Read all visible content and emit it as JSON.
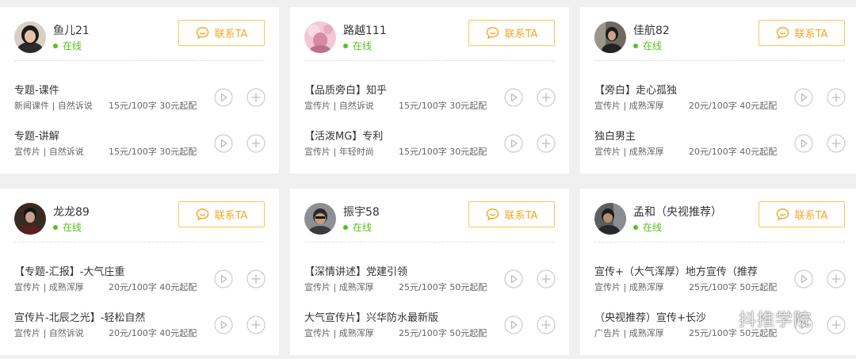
{
  "cards": [
    {
      "name": "鱼儿21",
      "status": "在线",
      "contact_label": "联系TA",
      "items": [
        {
          "title": "专题-课件",
          "tags": "新闻课件 | 自然诉说",
          "price": "15元/100字 30元起配"
        },
        {
          "title": "专题-讲解",
          "tags": "宣传片 | 自然诉说",
          "price": "15元/100字 30元起配"
        }
      ]
    },
    {
      "name": "路越111",
      "status": "在线",
      "contact_label": "联系TA",
      "items": [
        {
          "title": "【品质旁白】知乎",
          "tags": "宣传片 | 自然诉说",
          "price": "15元/100字 30元起配"
        },
        {
          "title": "【活泼MG】专利",
          "tags": "宣传片 | 年轻时尚",
          "price": "15元/100字 30元起配"
        }
      ]
    },
    {
      "name": "佳航82",
      "status": "在线",
      "contact_label": "联系TA",
      "items": [
        {
          "title": "【旁白】走心孤独",
          "tags": "宣传片 | 成熟浑厚",
          "price": "20元/100字 40元起配"
        },
        {
          "title": "独白男主",
          "tags": "宣传片 | 成熟浑厚",
          "price": "20元/100字 40元起配"
        }
      ]
    },
    {
      "name": "龙龙89",
      "status": "在线",
      "contact_label": "联系TA",
      "items": [
        {
          "title": "【专题-汇报】-大气庄重",
          "tags": "宣传片 | 成熟浑厚",
          "price": "20元/100字 40元起配"
        },
        {
          "title": "宣传片-北辰之光】-轻松自然",
          "tags": "宣传片 | 自然诉说",
          "price": "20元/100字 40元起配"
        }
      ]
    },
    {
      "name": "振宇58",
      "status": "在线",
      "contact_label": "联系TA",
      "items": [
        {
          "title": "【深情讲述】党建引领",
          "tags": "宣传片 | 成熟浑厚",
          "price": "25元/100字 50元起配"
        },
        {
          "title": "大气宣传片】兴华防水最新版",
          "tags": "宣传片 | 成熟浑厚",
          "price": "25元/100字 50元起配"
        }
      ]
    },
    {
      "name": "孟和（央视推荐）",
      "status": "在线",
      "contact_label": "联系TA",
      "items": [
        {
          "title": "宣传+（大气浑厚）地方宣传（推荐",
          "tags": "宣传片 | 成熟浑厚",
          "price": "25元/100字 50元起配"
        },
        {
          "title": "（央视推荐）宣传+长沙",
          "tags": "广告片 | 成熟浑厚",
          "price": "25元/100字 50元起配"
        }
      ]
    }
  ],
  "watermark": {
    "text": "抖推学院",
    "icon": "wechat-icon"
  },
  "colors": {
    "accent": "#f5a623",
    "accent_border": "#ffc259",
    "online": "#52c41a",
    "card_bg": "#ffffff",
    "page_bg": "#f0f0f0"
  }
}
